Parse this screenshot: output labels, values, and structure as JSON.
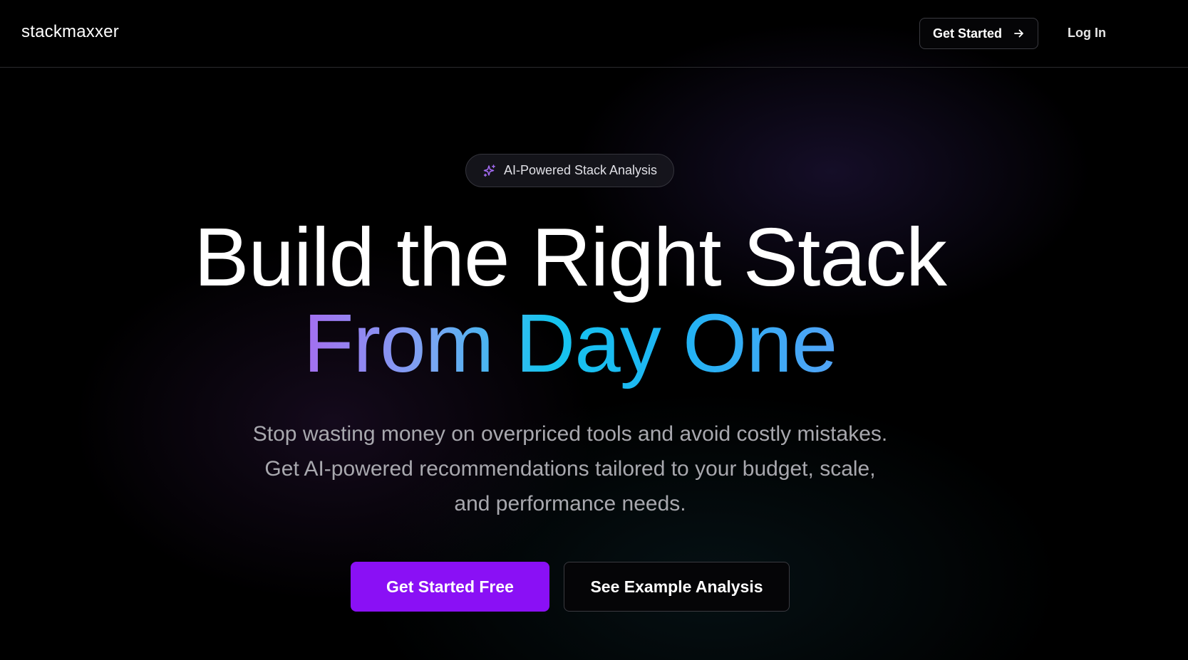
{
  "nav": {
    "logo": "stackmaxxer",
    "get_started_label": "Get Started",
    "login_label": "Log In"
  },
  "badge": {
    "label": "AI-Powered Stack Analysis",
    "icon": "sparkles-icon"
  },
  "hero": {
    "headline_line1": "Build the Right Stack",
    "headline_line2": "From Day One",
    "subtitle_line1": "Stop wasting money on overpriced tools and avoid costly mistakes.",
    "subtitle_line2": "Get AI-powered recommendations tailored to your budget, scale,",
    "subtitle_line3": "and performance needs."
  },
  "cta": {
    "primary_label": "Get Started Free",
    "secondary_label": "See Example Analysis"
  },
  "colors": {
    "background": "#000000",
    "primary_button": "#8a10f5",
    "gradient_start": "#a46ef0",
    "gradient_mid": "#16c4ee",
    "gradient_end": "#52a3f6",
    "badge_icon": "#a36bf2"
  }
}
